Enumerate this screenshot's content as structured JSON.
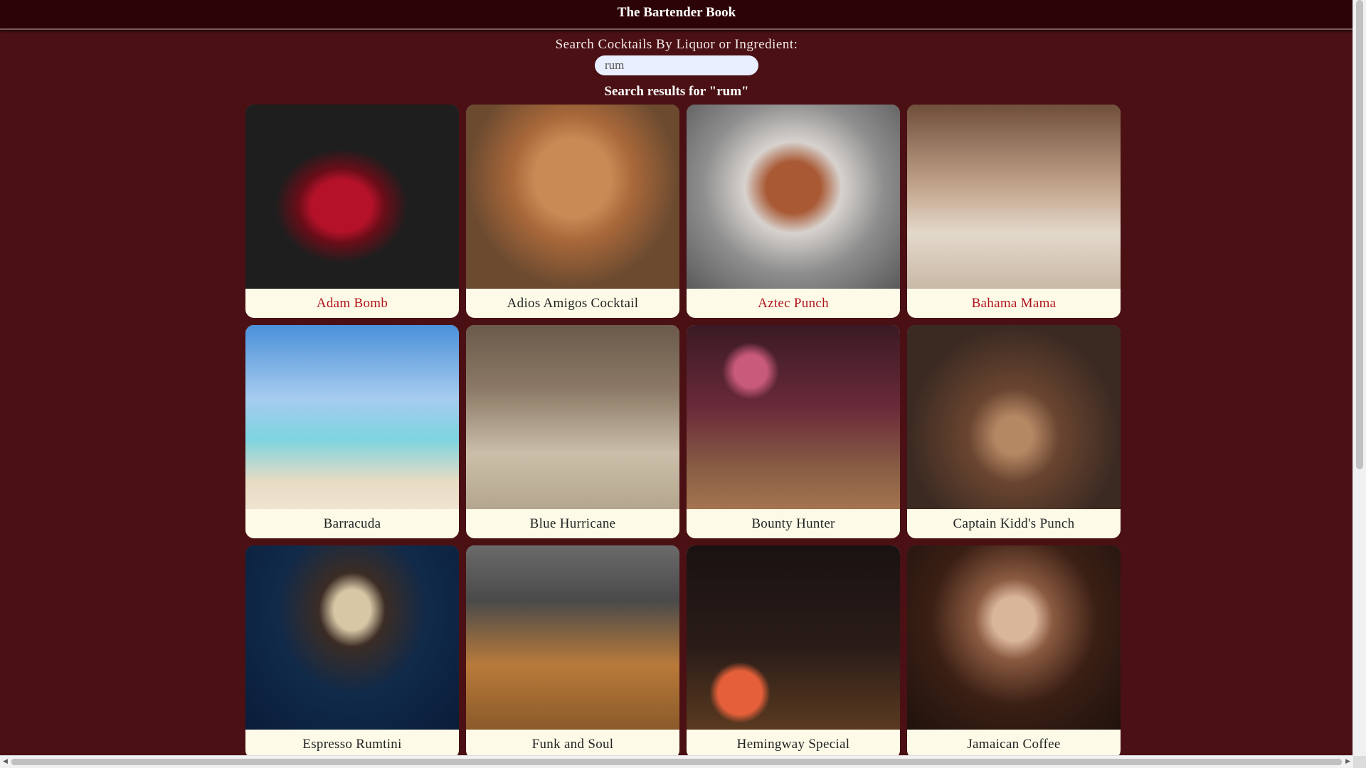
{
  "header": {
    "title": "The Bartender Book"
  },
  "search": {
    "label": "Search Cocktails By Liquor or Ingredient:",
    "value": "rum",
    "results_heading": "Search results for \"rum\""
  },
  "cards": [
    {
      "title": "Adam Bomb",
      "visited": true
    },
    {
      "title": "Adios Amigos Cocktail",
      "visited": false
    },
    {
      "title": "Aztec Punch",
      "visited": true
    },
    {
      "title": "Bahama Mama",
      "visited": true
    },
    {
      "title": "Barracuda",
      "visited": false
    },
    {
      "title": "Blue Hurricane",
      "visited": false
    },
    {
      "title": "Bounty Hunter",
      "visited": false
    },
    {
      "title": "Captain Kidd's Punch",
      "visited": false
    },
    {
      "title": "Espresso Rumtini",
      "visited": false
    },
    {
      "title": "Funk and Soul",
      "visited": false
    },
    {
      "title": "Hemingway Special",
      "visited": false
    },
    {
      "title": "Jamaican Coffee",
      "visited": false
    }
  ],
  "colors": {
    "background": "#4a1014",
    "header_bg": "#2c0306",
    "card_bg": "#fdfbe8",
    "visited_link": "#b0141c"
  }
}
